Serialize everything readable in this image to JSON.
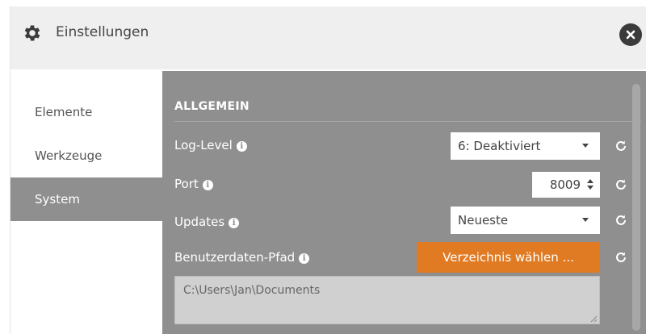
{
  "window": {
    "title": "Einstellungen",
    "title_icon": "gear-icon",
    "close_icon": "close-icon"
  },
  "sidebar": {
    "items": [
      {
        "label": "Elemente",
        "active": false
      },
      {
        "label": "Werkzeuge",
        "active": false
      },
      {
        "label": "System",
        "active": true
      }
    ]
  },
  "content": {
    "section_title": "ALLGEMEIN",
    "log_level": {
      "label": "Log-Level",
      "value": "6: Deaktiviert"
    },
    "port": {
      "label": "Port",
      "value": "8009"
    },
    "updates": {
      "label": "Updates",
      "value": "Neueste"
    },
    "user_data_path": {
      "label": "Benutzerdaten-Pfad",
      "button_label": "Verzeichnis wählen ...",
      "value": "C:\\Users\\Jan\\Documents"
    }
  },
  "colors": {
    "panel": "#8f8f8f",
    "accent": "#e07b24",
    "titlebar": "#efefef"
  }
}
